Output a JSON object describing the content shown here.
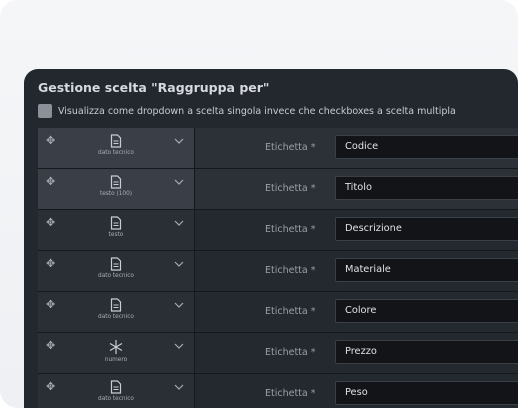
{
  "panel": {
    "title": "Gestione scelta \"Raggruppa per\"",
    "checkbox_label": "Visualizza come dropdown a scelta singola invece che checkboxes a scelta multipla",
    "checkbox_checked": false
  },
  "field_label": "Etichetta *",
  "rows": [
    {
      "type_label": "dato tecnico",
      "type_icon": "document-icon",
      "value": "Codice",
      "highlighted": true
    },
    {
      "type_label": "testo (100)",
      "type_icon": "document-icon",
      "value": "Titolo",
      "highlighted": true
    },
    {
      "type_label": "testo",
      "type_icon": "document-icon",
      "value": "Descrizione",
      "highlighted": false
    },
    {
      "type_label": "dato tecnico",
      "type_icon": "document-icon",
      "value": "Materiale",
      "highlighted": false
    },
    {
      "type_label": "dato tecnico",
      "type_icon": "document-icon",
      "value": "Colore",
      "highlighted": false
    },
    {
      "type_label": "numero",
      "type_icon": "asterisk-icon",
      "value": "Prezzo",
      "highlighted": false
    },
    {
      "type_label": "dato tecnico",
      "type_icon": "document-icon",
      "value": "Peso",
      "highlighted": false
    }
  ],
  "colors": {
    "panel_bg": "#23272e",
    "input_bg": "#121417",
    "text_primary": "#dfe2e6",
    "text_muted": "#9aa0a8"
  }
}
